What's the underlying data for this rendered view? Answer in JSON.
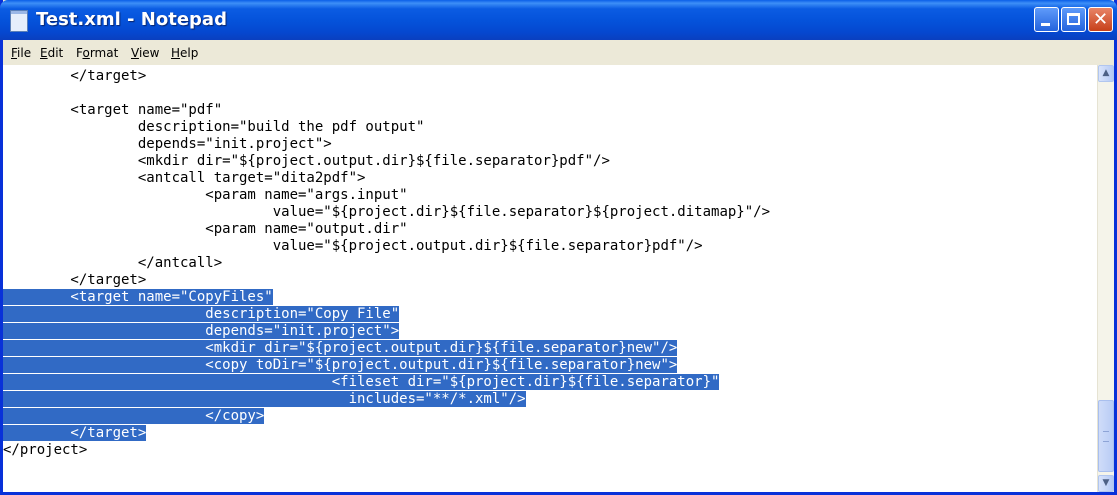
{
  "window": {
    "title": "Test.xml - Notepad",
    "icons": {
      "app": "notepad-icon",
      "minimize": "minimize-icon",
      "maximize": "maximize-icon",
      "close": "close-icon"
    },
    "close_glyph": "✕"
  },
  "menu": {
    "items": [
      {
        "hot": "F",
        "rest": "ile"
      },
      {
        "hot": "E",
        "rest": "dit"
      },
      {
        "pre": "F",
        "hot": "o",
        "rest": "rmat"
      },
      {
        "hot": "V",
        "rest": "iew"
      },
      {
        "hot": "H",
        "rest": "elp"
      }
    ]
  },
  "editor": {
    "lines": [
      {
        "text": "        </target>",
        "selected": ""
      },
      {
        "text": "",
        "selected": ""
      },
      {
        "text": "        <target name=\"pdf\"",
        "selected": ""
      },
      {
        "text": "                description=\"build the pdf output\"",
        "selected": ""
      },
      {
        "text": "                depends=\"init.project\">",
        "selected": ""
      },
      {
        "text": "                <mkdir dir=\"${project.output.dir}${file.separator}pdf\"/>",
        "selected": ""
      },
      {
        "text": "                <antcall target=\"dita2pdf\">",
        "selected": ""
      },
      {
        "text": "                        <param name=\"args.input\"",
        "selected": ""
      },
      {
        "text": "                                value=\"${project.dir}${file.separator}${project.ditamap}\"/>",
        "selected": ""
      },
      {
        "text": "                        <param name=\"output.dir\"",
        "selected": ""
      },
      {
        "text": "                                value=\"${project.output.dir}${file.separator}pdf\"/>",
        "selected": ""
      },
      {
        "text": "                </antcall>",
        "selected": ""
      },
      {
        "text": "        </target>",
        "selected": ""
      },
      {
        "text": "",
        "selected": "        <target name=\"CopyFiles\""
      },
      {
        "text": "",
        "selected": "                        description=\"Copy File\""
      },
      {
        "text": "",
        "selected": "                        depends=\"init.project\">"
      },
      {
        "text": "",
        "selected": "                        <mkdir dir=\"${project.output.dir}${file.separator}new\"/>"
      },
      {
        "text": "",
        "selected": "                        <copy toDir=\"${project.output.dir}${file.separator}new\">"
      },
      {
        "text": "",
        "selected": "                                       <fileset dir=\"${project.dir}${file.separator}\""
      },
      {
        "text": "",
        "selected": "                                         includes=\"**/*.xml\"/>"
      },
      {
        "text": "",
        "selected": "                        </copy>"
      },
      {
        "text": "",
        "selected": "        </target>"
      },
      {
        "text": "</project>",
        "selected": ""
      }
    ]
  },
  "scrollbar": {
    "up_arrow": "▲",
    "down_arrow": "▼",
    "icons": {
      "up": "scroll-up-arrow-icon",
      "down": "scroll-down-arrow-icon"
    }
  }
}
